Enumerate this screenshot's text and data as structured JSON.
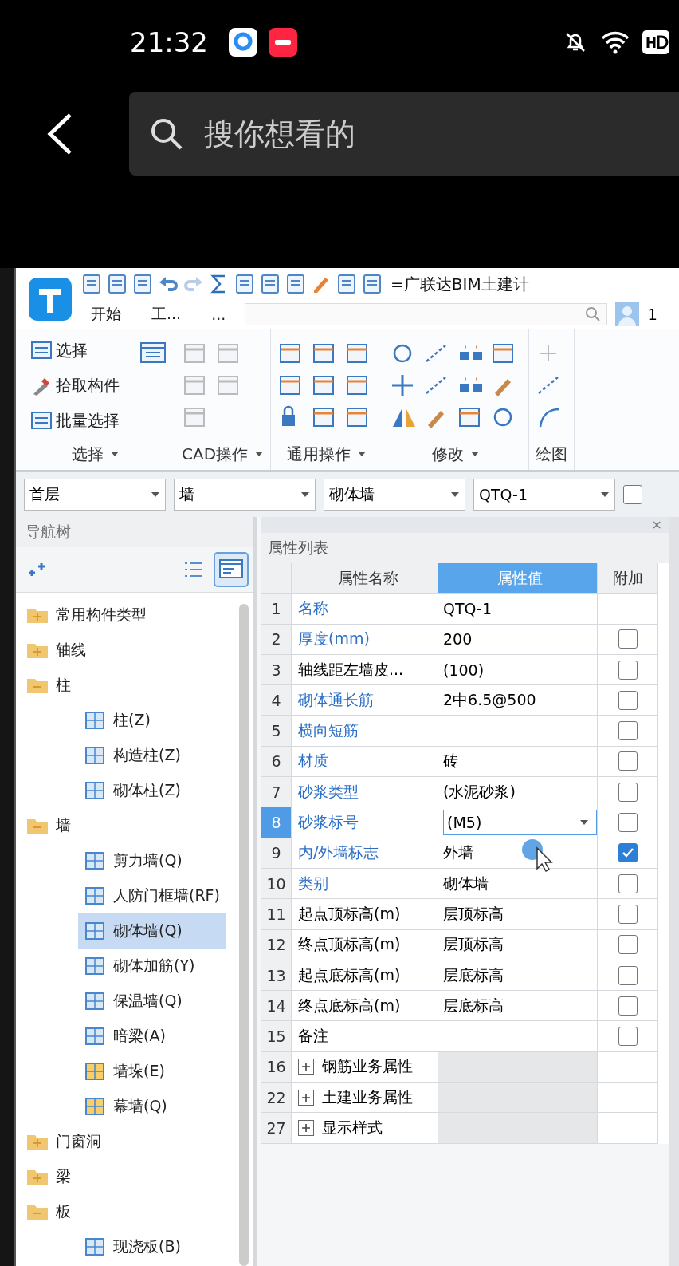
{
  "status_bar": {
    "time": "21:32"
  },
  "search": {
    "placeholder": "搜你想看的"
  },
  "app": {
    "title": "=广联达BIM土建计",
    "user": "1",
    "tabs": [
      "开始",
      "工...",
      "..."
    ],
    "ribbon_groups": [
      {
        "label": "选择",
        "buttons": [
          "选择",
          "拾取构件",
          "批量选择"
        ]
      },
      {
        "label": "CAD操作"
      },
      {
        "label": "通用操作"
      },
      {
        "label": "修改"
      },
      {
        "label": "绘图"
      }
    ],
    "selectors": [
      {
        "value": "首层"
      },
      {
        "value": "墙"
      },
      {
        "value": "砌体墙"
      },
      {
        "value": "QTQ-1"
      }
    ],
    "option_checkbox": {
      "checked": false
    },
    "nav_tree": {
      "title": "导航树",
      "items": [
        {
          "label": "常用构件类型",
          "expanded": false,
          "selected": false
        },
        {
          "label": "轴线",
          "expanded": false,
          "selected": false
        },
        {
          "label": "柱",
          "expanded": true,
          "selected": false,
          "children": [
            {
              "label": "柱(Z)",
              "selected": false
            },
            {
              "label": "构造柱(Z)",
              "selected": false
            },
            {
              "label": "砌体柱(Z)",
              "selected": false
            }
          ]
        },
        {
          "label": "墙",
          "expanded": true,
          "selected": false,
          "children": [
            {
              "label": "剪力墙(Q)",
              "selected": false
            },
            {
              "label": "人防门框墙(RF)",
              "selected": false
            },
            {
              "label": "砌体墙(Q)",
              "selected": true
            },
            {
              "label": "砌体加筋(Y)",
              "selected": false
            },
            {
              "label": "保温墙(Q)",
              "selected": false
            },
            {
              "label": "暗梁(A)",
              "selected": false
            },
            {
              "label": "墙垛(E)",
              "selected": false
            },
            {
              "label": "幕墙(Q)",
              "selected": false
            }
          ]
        },
        {
          "label": "门窗洞",
          "expanded": false,
          "selected": false
        },
        {
          "label": "梁",
          "expanded": false,
          "selected": false
        },
        {
          "label": "板",
          "expanded": true,
          "selected": false,
          "children": [
            {
              "label": "现浇板(B)",
              "selected": false
            }
          ]
        }
      ]
    },
    "properties": {
      "title": "属性列表",
      "close": "×",
      "columns": [
        {
          "label": "属性名称",
          "selected": false
        },
        {
          "label": "属性值",
          "selected": true
        },
        {
          "label": "附加",
          "selected": false
        }
      ],
      "rows": [
        {
          "kind": "fixed",
          "no": "1",
          "name": "名称",
          "value": "QTQ-1",
          "public": true,
          "selected": false
        },
        {
          "kind": "property",
          "no": "2",
          "name": "厚度(mm)",
          "value": "200",
          "public": true,
          "checked": false,
          "selected": false
        },
        {
          "kind": "property",
          "no": "3",
          "name": "轴线距左墙皮...",
          "value": "(100)",
          "public": false,
          "checked": false,
          "selected": false
        },
        {
          "kind": "property",
          "no": "4",
          "name": "砌体通长筋",
          "value": "2中6.5@500",
          "public": true,
          "checked": false,
          "selected": false
        },
        {
          "kind": "property",
          "no": "5",
          "name": "横向短筋",
          "value": "",
          "public": true,
          "checked": false,
          "selected": false
        },
        {
          "kind": "property",
          "no": "6",
          "name": "材质",
          "value": "砖",
          "public": true,
          "checked": false,
          "selected": false
        },
        {
          "kind": "property",
          "no": "7",
          "name": "砂浆类型",
          "value": "(水泥砂浆)",
          "public": true,
          "checked": false,
          "selected": false
        },
        {
          "kind": "property",
          "no": "8",
          "name": "砂浆标号",
          "value": "(M5)",
          "public": true,
          "checked": false,
          "selected": true
        },
        {
          "kind": "property",
          "no": "9",
          "name": "内/外墙标志",
          "value": "外墙",
          "public": true,
          "checked": true,
          "selected": false
        },
        {
          "kind": "property",
          "no": "10",
          "name": "类别",
          "value": "砌体墙",
          "public": true,
          "checked": false,
          "selected": false
        },
        {
          "kind": "property",
          "no": "11",
          "name": "起点顶标高(m)",
          "value": "层顶标高",
          "public": false,
          "checked": false,
          "selected": false
        },
        {
          "kind": "property",
          "no": "12",
          "name": "终点顶标高(m)",
          "value": "层顶标高",
          "public": false,
          "checked": false,
          "selected": false
        },
        {
          "kind": "property",
          "no": "13",
          "name": "起点底标高(m)",
          "value": "层底标高",
          "public": false,
          "checked": false,
          "selected": false
        },
        {
          "kind": "property",
          "no": "14",
          "name": "终点底标高(m)",
          "value": "层底标高",
          "public": false,
          "checked": false,
          "selected": false
        },
        {
          "kind": "property",
          "no": "15",
          "name": "备注",
          "value": "",
          "public": false,
          "checked": false,
          "selected": false
        },
        {
          "kind": "group",
          "no": "16",
          "name": "钢筋业务属性",
          "expanded": false,
          "selected": false
        },
        {
          "kind": "group",
          "no": "22",
          "name": "土建业务属性",
          "expanded": false,
          "selected": false
        },
        {
          "kind": "group",
          "no": "27",
          "name": "显示样式",
          "expanded": false,
          "selected": false
        }
      ]
    }
  }
}
